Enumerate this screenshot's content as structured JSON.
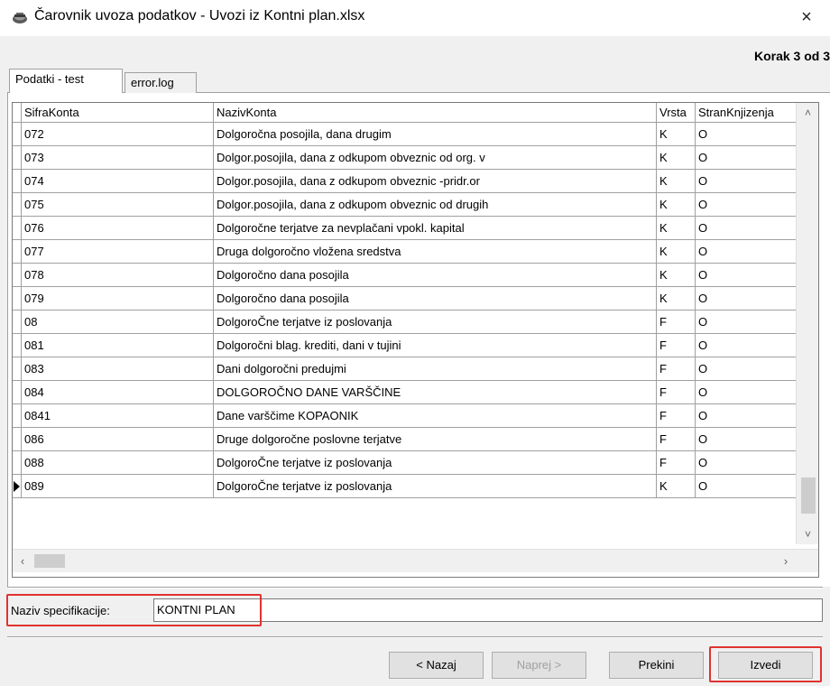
{
  "window": {
    "title": "Čarovnik uvoza podatkov - Uvozi iz Kontni plan.xlsx",
    "close_glyph": "×",
    "icon": "wizard-icon"
  },
  "step": "Korak 3 od 3",
  "tabs": [
    {
      "label": "Podatki - test",
      "active": true
    },
    {
      "label": "error.log",
      "active": false
    }
  ],
  "grid": {
    "columns": [
      "SifraKonta",
      "NazivKonta",
      "Vrsta",
      "StranKnjizenja"
    ],
    "rows": [
      [
        "072",
        "Dolgoročna posojila, dana drugim",
        "K",
        "O"
      ],
      [
        "073",
        "Dolgor.posojila, dana z odkupom obveznic od org. v",
        "K",
        "O"
      ],
      [
        "074",
        "Dolgor.posojila, dana z odkupom obveznic -pridr.or",
        "K",
        "O"
      ],
      [
        "075",
        "Dolgor.posojila, dana z odkupom obveznic od drugih",
        "K",
        "O"
      ],
      [
        "076",
        "Dolgoročne terjatve za nevplačani vpokl. kapital",
        "K",
        "O"
      ],
      [
        "077",
        "Druga dolgoročno vložena sredstva",
        "K",
        "O"
      ],
      [
        "078",
        "Dolgoročno dana posojila",
        "K",
        "O"
      ],
      [
        "079",
        "Dolgoročno dana posojila",
        "K",
        "O"
      ],
      [
        "08",
        "DolgoroČne terjatve iz   poslovanja",
        "F",
        "O"
      ],
      [
        "081",
        "Dolgoročni blag. krediti, dani v tujini",
        "F",
        "O"
      ],
      [
        "083",
        "Dani dolgoročni predujmi",
        "F",
        "O"
      ],
      [
        "084",
        "DOLGOROČNO DANE VARŠČINE",
        "F",
        "O"
      ],
      [
        "0841",
        "Dane varščime  KOPAONIK",
        "F",
        "O"
      ],
      [
        "086",
        "Druge dolgoročne poslovne terjatve",
        "F",
        "O"
      ],
      [
        "088",
        "DolgoroČne terjatve iz   poslovanja",
        "F",
        "O"
      ],
      [
        "089",
        "DolgoroČne terjatve iz   poslovanja",
        "K",
        "O"
      ]
    ],
    "current_row": 15
  },
  "spec": {
    "label": "Naziv specifikacije:",
    "value": "KONTNI PLAN"
  },
  "buttons": {
    "back": "< Nazaj",
    "next": "Naprej >",
    "cancel": "Prekini",
    "finish": "Izvedi"
  },
  "colors": {
    "highlight": "#e0332f"
  }
}
